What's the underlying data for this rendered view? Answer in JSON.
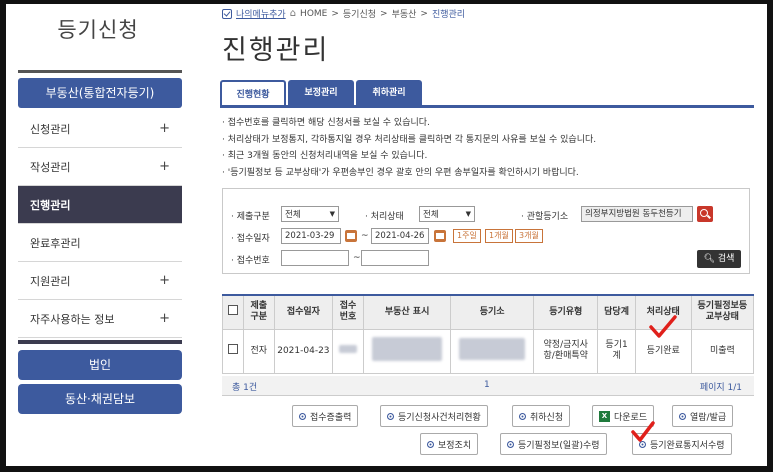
{
  "sidebar": {
    "title": "등기신청",
    "header": "부동산(통합전자등기)",
    "items": [
      {
        "label": "신청관리",
        "plus": "+"
      },
      {
        "label": "작성관리",
        "plus": "+"
      },
      {
        "label": "진행관리",
        "plus": ""
      },
      {
        "label": "완료후관리",
        "plus": ""
      },
      {
        "label": "지원관리",
        "plus": "+"
      },
      {
        "label": "자주사용하는 정보",
        "plus": "+"
      }
    ],
    "btn1": "법인",
    "btn2": "동산·채권담보"
  },
  "breadcrumb": {
    "mymenu": "나의메뉴추가",
    "home": "HOME",
    "sep": ">",
    "c1": "등기신청",
    "c2": "부동산",
    "c3": "진행관리"
  },
  "page_title": "진행관리",
  "tabs": [
    "진행현황",
    "보정관리",
    "취하관리"
  ],
  "notes": [
    "· 접수번호를 클릭하면 해당 신청서를 보실 수 있습니다.",
    "· 처리상태가 보정통지, 각하통지일 경우 처리상태를 클릭하면 각 통지문의 사유를 보실 수 있습니다.",
    "· 최근 3개월 동안의 신청처리내역을 보실 수 있습니다.",
    "· '등기필정보 등 교부상태'가 우편송부인 경우 괄호 안의 우편 송부일자를 확인하시기 바랍니다."
  ],
  "search": {
    "l_submit": "· 제출구분",
    "v_submit": "전체",
    "l_status": "· 처리상태",
    "v_status": "전체",
    "l_court": "· 관할등기소",
    "v_court": "의정부지방법원 동두천등기",
    "l_date": "· 접수일자",
    "date_from": "2021-03-29",
    "date_to": "2021-04-26",
    "tilde": "~",
    "p1": "1주일",
    "p2": "1개월",
    "p3": "3개월",
    "l_no": "· 접수번호",
    "search_btn": "검색"
  },
  "table": {
    "headers": [
      "제출\n구분",
      "접수일자",
      "접수\n번호",
      "부동산 표시",
      "등기소",
      "등기유형",
      "담당계",
      "처리상태",
      "등기필정보등\n교부상태"
    ],
    "row": {
      "submit": "전자",
      "date": "2021-04-23",
      "type": "약정/금지사항/환매특약",
      "team": "등기1계",
      "status": "등기완료",
      "delivery": "미출력"
    }
  },
  "summary": {
    "count": "총 1건",
    "page": "1",
    "pages": "페이지 1/1"
  },
  "actions": {
    "b1": "접수증출력",
    "b2": "등기신청사건처리현황",
    "b3": "취하신청",
    "b4": "다운로드",
    "b5": "열람/발급",
    "b6": "보정조치",
    "b7": "등기필정보(일괄)수령",
    "b8": "등기완료통지서수령"
  },
  "colors": {
    "primary": "#3d5a9e",
    "active_menu": "#3b3b4f",
    "accent": "#c8743a",
    "annotation": "#e0201b"
  }
}
